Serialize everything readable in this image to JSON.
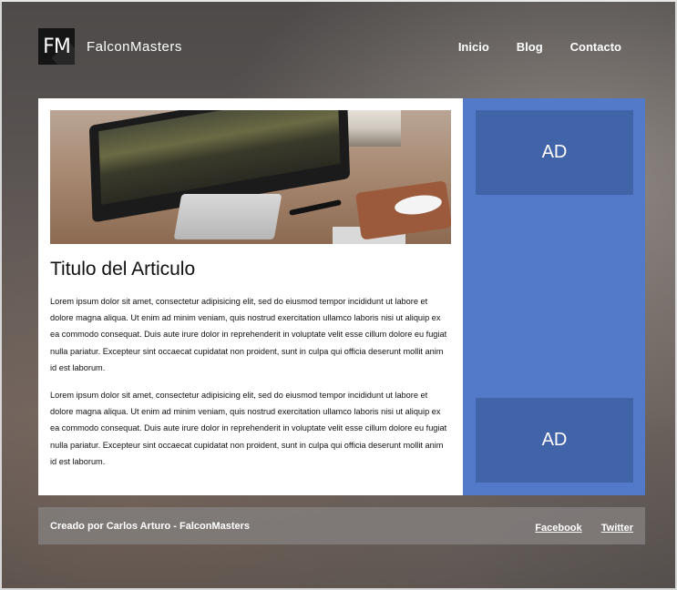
{
  "header": {
    "logo_text": "FM",
    "brand_name": "FalconMasters",
    "nav": [
      {
        "label": "Inicio"
      },
      {
        "label": "Blog"
      },
      {
        "label": "Contacto"
      }
    ]
  },
  "article": {
    "title": "Titulo del Articulo",
    "paragraphs": [
      "Lorem ipsum dolor sit amet, consectetur adipisicing elit, sed do eiusmod tempor incididunt ut labore et dolore magna aliqua. Ut enim ad minim veniam, quis nostrud exercitation ullamco laboris nisi ut aliquip ex ea commodo consequat. Duis aute irure dolor in reprehenderit in voluptate velit esse cillum dolore eu fugiat nulla pariatur. Excepteur sint occaecat cupidatat non proident, sunt in culpa qui officia deserunt mollit anim id est laborum.",
      "Lorem ipsum dolor sit amet, consectetur adipisicing elit, sed do eiusmod tempor incididunt ut labore et dolore magna aliqua. Ut enim ad minim veniam, quis nostrud exercitation ullamco laboris nisi ut aliquip ex ea commodo consequat. Duis aute irure dolor in reprehenderit in voluptate velit esse cillum dolore eu fugiat nulla pariatur. Excepteur sint occaecat cupidatat non proident, sunt in culpa qui officia deserunt mollit anim id est laborum."
    ]
  },
  "sidebar": {
    "ads": [
      {
        "label": "AD"
      },
      {
        "label": "AD"
      }
    ]
  },
  "footer": {
    "credit": "Creado por Carlos Arturo - FalconMasters",
    "links": [
      {
        "label": "Facebook"
      },
      {
        "label": "Twitter"
      }
    ]
  },
  "colors": {
    "sidebar": "#527ac8",
    "ad_box": "#4163a7",
    "footer": "#827e7c",
    "logo_bg": "#151515"
  }
}
